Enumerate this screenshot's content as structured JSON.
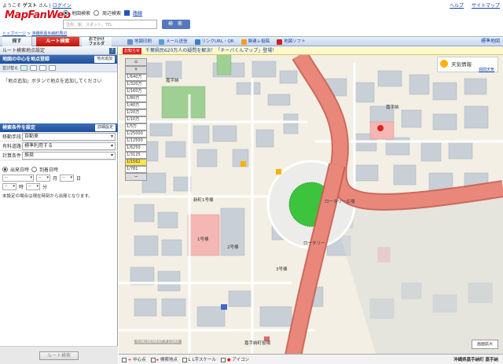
{
  "header": {
    "welcome_prefix": "ようこそ",
    "user": "ゲスト",
    "welcome_suffix": "さん",
    "login": "ログイン",
    "help": "ヘルプ",
    "sitemap": "サイトマップ",
    "logo": "MapFanWeb",
    "radio_map": "地図検索",
    "radio_nearby": "周辺検索",
    "check_route": "路線",
    "search_placeholder": "住所、駅、スポット、TEL",
    "search_button": "検 索",
    "breadcrumb": [
      "トップページ",
      "沖縄県嘉手納町周辺"
    ]
  },
  "nav": {
    "tab_search": "探す",
    "tab_route": "ルート検索",
    "tab_folder_top": "おでかけ",
    "tab_folder_bottom": "フォルダ",
    "items": [
      "地図印刷",
      "メール送信",
      "リンクURL・QR",
      "関連レ投稿",
      "地図ソフト"
    ],
    "standard_map": "標準地図"
  },
  "left_panel": {
    "title": "ルート検索地点設定",
    "point_header": "地図の中心を地点登録",
    "point_button": "地点追加",
    "sort_label": "並び替え",
    "hint": "「地点追加」ボタンで地点を追加してください",
    "cond_header": "検索条件を設定",
    "cond_button": "詳細設定",
    "rows": [
      {
        "label": "移動手段",
        "value": "自動車"
      },
      {
        "label": "有料道路",
        "value": "標準利用する"
      },
      {
        "label": "計算条件",
        "value": "推奨"
      }
    ],
    "depart_label": "出発日時",
    "arrive_label": "到着日時",
    "unit_month": "月",
    "unit_day": "日",
    "unit_hour": "時",
    "unit_min": "分",
    "dash": "--",
    "note": "未設定の場合は現在時刻から出発となります。",
    "route_button": "ルート検索"
  },
  "map": {
    "ticker_tag": "お知らせ",
    "ticker_msg": "千葉県民620万人の疑問を解決！「チーバくんマップ」登場！",
    "zoom_levels": [
      "1/640万",
      "1/320万",
      "1/160万",
      "1/80万",
      "1/40万",
      "1/20万",
      "1/10万",
      "1/5万",
      "1/25000",
      "1/12500",
      "1/6250",
      "1/3125",
      "1/1562",
      "1/781"
    ],
    "active_zoom": "1/1562",
    "weather_title": "天気情報",
    "weather_link": "週間天気",
    "copyright": "©INCREMENT P CORP.",
    "fullview": "画面拡大",
    "labels": {
      "kadena_n": "嘉手納",
      "kadena_e": "嘉手納",
      "station": "嘉手納町役場",
      "rotary": "ロータリー",
      "ward1": "1号棟",
      "ward2": "2号棟",
      "ward3": "3号棟",
      "market": "新町1号棟",
      "town_hall": "嘉手納町役場",
      "okinawa": "沖縄県嘉手納町 嘉手納",
      "green": "ロータリー広場"
    },
    "legend": [
      "中心点",
      "検索地点",
      "L字スケール",
      "アイコン"
    ],
    "address": "沖縄県嘉手納町 嘉手納",
    "colors": {
      "road_main": "#e9877a",
      "road_edge": "#c95b4f",
      "park": "#3cc43c",
      "green_block": "#9fcf92",
      "pink_block": "#f4b7b3",
      "building": "#c8cfd6",
      "ground": "#f3efe4"
    }
  }
}
